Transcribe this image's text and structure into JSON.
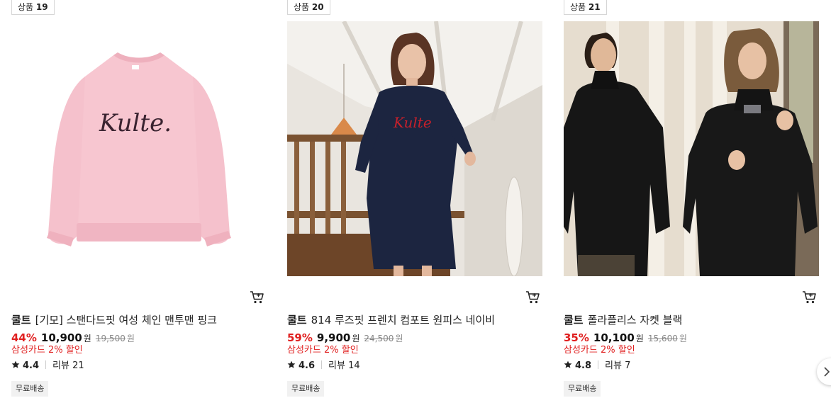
{
  "products": [
    {
      "rank_label": "상품",
      "rank_number": "19",
      "brand": "쿨트",
      "name": "[기모] 스탠다드핏 여성 체인 맨투맨 핑크",
      "discount": "44%",
      "price": "10,900",
      "currency": "원",
      "original_price": "19,500",
      "card_benefit": "삼성카드 2% 할인",
      "rating": "4.4",
      "review_label": "리뷰",
      "review_count": "21",
      "shipping": "무료배송",
      "image_logo_text": "Kulte."
    },
    {
      "rank_label": "상품",
      "rank_number": "20",
      "brand": "쿨트",
      "name": "814 루즈핏 프렌치 컴포트 원피스 네이비",
      "discount": "59%",
      "price": "9,900",
      "currency": "원",
      "original_price": "24,500",
      "card_benefit": "삼성카드 2% 할인",
      "rating": "4.6",
      "review_label": "리뷰",
      "review_count": "14",
      "shipping": "무료배송",
      "image_logo_text": "Kulte"
    },
    {
      "rank_label": "상품",
      "rank_number": "21",
      "brand": "쿨트",
      "name": "폴라플리스 자켓 블랙",
      "discount": "35%",
      "price": "10,100",
      "currency": "원",
      "original_price": "15,600",
      "card_benefit": "삼성카드 2% 할인",
      "rating": "4.8",
      "review_label": "리뷰",
      "review_count": "7",
      "shipping": "무료배송"
    }
  ],
  "colors": {
    "discount": "#e02020",
    "card_benefit": "#e02020",
    "badge_border": "#d6d6d6",
    "shipping_bg": "#f1f1f1"
  },
  "icons": {
    "cart": "shopping-cart-icon",
    "star": "star-icon",
    "next": "chevron-right-icon"
  }
}
